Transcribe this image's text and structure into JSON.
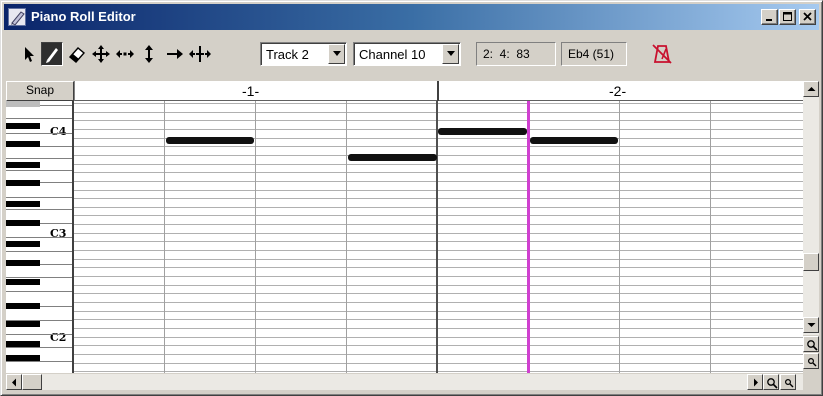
{
  "window": {
    "title": "Piano Roll Editor",
    "accent": "#0a246a",
    "caption_buttons": [
      "minimize-icon",
      "maximize-icon",
      "close-icon"
    ]
  },
  "toolbar": {
    "tools": [
      {
        "name": "pointer",
        "icon": "arrow-pointer-icon",
        "active": false
      },
      {
        "name": "pencil",
        "icon": "pencil-icon",
        "active": true
      },
      {
        "name": "eraser",
        "icon": "eraser-icon",
        "active": false
      },
      {
        "name": "move",
        "icon": "four-way-move-icon",
        "active": false
      },
      {
        "name": "horizontal-resize",
        "icon": "horizontal-resize-icon",
        "active": false
      },
      {
        "name": "vertical-resize",
        "icon": "vertical-resize-icon",
        "active": false
      },
      {
        "name": "right-arrow",
        "icon": "right-arrow-icon",
        "active": false
      },
      {
        "name": "stretch",
        "icon": "stretch-icon",
        "active": false
      }
    ],
    "track": "Track 2",
    "channel": "Channel 10",
    "position": "2:  4:  83",
    "pitch": "Eb4 (51)",
    "metronome_icon": "metronome-icon"
  },
  "editor": {
    "snap_label": "Snap",
    "ruler_labels": [
      "-1-",
      "-2-"
    ],
    "octave_labels": [
      "C4",
      "C3",
      "C2"
    ],
    "playhead_color": "#d040d0"
  }
}
